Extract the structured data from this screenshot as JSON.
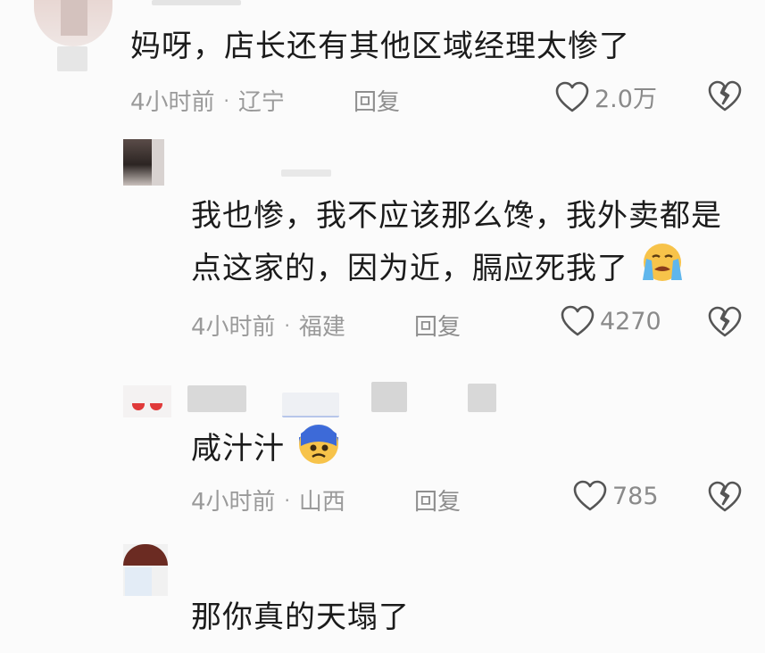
{
  "comments": [
    {
      "text": "妈呀，店长还有其他区域经理太惨了",
      "time": "4小时前",
      "location": "辽宁",
      "reply_label": "回复",
      "likes": "2.0万"
    },
    {
      "text_line1": "我也惨，我不应该那么馋，我外卖都是",
      "text_line2": "点这家的，因为近，膈应死我了",
      "emoji": "crying-face-emoji",
      "time": "4小时前",
      "location": "福建",
      "reply_label": "回复",
      "likes": "4270"
    },
    {
      "text": "咸汁汁",
      "emoji": "anxious-blue-face-emoji",
      "time": "4小时前",
      "location": "山西",
      "reply_label": "回复",
      "likes": "785"
    },
    {
      "text": "那你真的天塌了"
    }
  ],
  "icons": {
    "like": "heart-outline-icon",
    "dislike": "broken-heart-icon"
  },
  "colors": {
    "meta_gray": "#9a9a9a",
    "text": "#1b1b1b",
    "background": "#fbfbfb"
  }
}
